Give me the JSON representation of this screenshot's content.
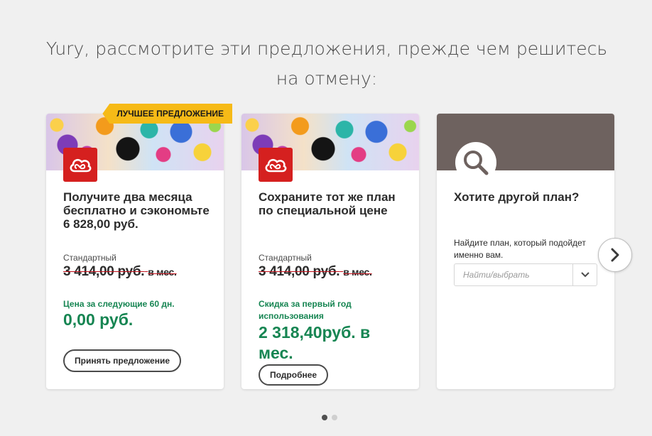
{
  "headline": "Yury, рассмотрите эти предложения, прежде чем решитесь на отмену:",
  "offers": [
    {
      "badge": "ЛУЧШЕЕ ПРЕДЛОЖЕНИЕ",
      "title": "Получите два месяца бесплатно и сэкономьте 6 828,00 руб.",
      "plan_name": "Стандартный",
      "old_price": "3 414,00 руб.",
      "old_price_period": "в мес.",
      "offer_label": "Цена за следующие 60 дн.",
      "new_price": "0,00 руб.",
      "button_label": "Принять предложение"
    },
    {
      "title": "Сохраните тот же план по специальной цене",
      "plan_name": "Стандартный",
      "old_price": "3 414,00 руб.",
      "old_price_period": "в мес.",
      "offer_label": "Скидка за первый год использования",
      "new_price": "2 318,40руб. в мес.",
      "button_label": "Подробнее"
    }
  ],
  "other_plan": {
    "title": "Хотите другой план?",
    "help_text": "Найдите план, который подойдет именно вам.",
    "select_placeholder": "Найти/выбрать"
  },
  "icons": {
    "app_logo": "creative-cloud-icon",
    "search": "magnifier-icon",
    "dropdown": "chevron-down-icon",
    "next": "chevron-right-icon"
  },
  "carousel": {
    "pages": 2,
    "active_page": 1
  },
  "colors": {
    "accent_green": "#168552",
    "badge_yellow": "#f6ba17",
    "logo_red": "#d5201f",
    "strike_red": "#c3111b"
  }
}
